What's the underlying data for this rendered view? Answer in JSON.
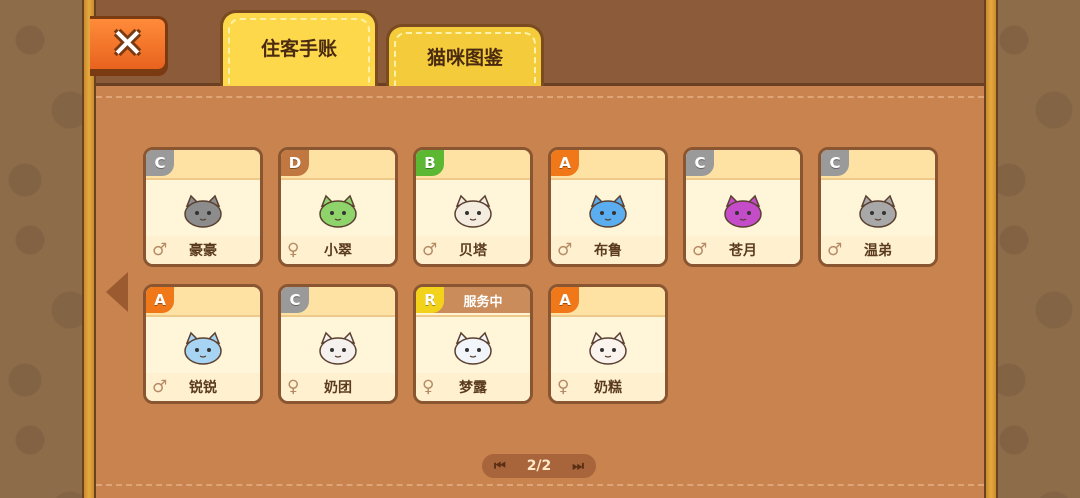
{
  "tabs": [
    {
      "label": "住客手账",
      "active": true
    },
    {
      "label": "猫咪图鉴",
      "active": false
    }
  ],
  "rarity_colors": {
    "A": "#f07818",
    "B": "#5cb833",
    "C": "#9a9a9a",
    "D": "#c07840",
    "R": "#f2d21a"
  },
  "cats": [
    {
      "rarity": "C",
      "name": "豪豪",
      "gender": "♂",
      "icon": "gray-tabby-cat-icon",
      "color": "#8c8c8c",
      "status": ""
    },
    {
      "rarity": "D",
      "name": "小翠",
      "gender": "♀",
      "icon": "green-parrot-cat-icon",
      "color": "#8fd46a",
      "status": ""
    },
    {
      "rarity": "B",
      "name": "贝塔",
      "gender": "♂",
      "icon": "siamese-cat-icon",
      "color": "#f5ece0",
      "status": ""
    },
    {
      "rarity": "A",
      "name": "布鲁",
      "gender": "♂",
      "icon": "blue-white-cat-icon",
      "color": "#5aaef0",
      "status": ""
    },
    {
      "rarity": "C",
      "name": "苍月",
      "gender": "♂",
      "icon": "purple-spiky-cat-icon",
      "color": "#c44cc8",
      "status": ""
    },
    {
      "rarity": "C",
      "name": "温弟",
      "gender": "♂",
      "icon": "sleepy-gray-cat-icon",
      "color": "#a8a8a8",
      "status": ""
    },
    {
      "rarity": "A",
      "name": "锐锐",
      "gender": "♂",
      "icon": "ice-blue-cat-icon",
      "color": "#a8d4f4",
      "status": ""
    },
    {
      "rarity": "C",
      "name": "奶团",
      "gender": "♀",
      "icon": "white-cat-icon",
      "color": "#f4f1ee",
      "status": ""
    },
    {
      "rarity": "R",
      "name": "梦露",
      "gender": "♀",
      "icon": "white-fluffy-cat-icon",
      "color": "#f2f6fa",
      "status": "服务中"
    },
    {
      "rarity": "A",
      "name": "奶糕",
      "gender": "♀",
      "icon": "white-cream-cat-icon",
      "color": "#fbf4ee",
      "status": ""
    }
  ],
  "pager": {
    "label": "2/2",
    "prev_icon": "first-page-icon",
    "next_icon": "next-page-icon"
  },
  "nav": {
    "left_arrow_icon": "left-arrow-icon",
    "close_icon": "close-icon"
  }
}
